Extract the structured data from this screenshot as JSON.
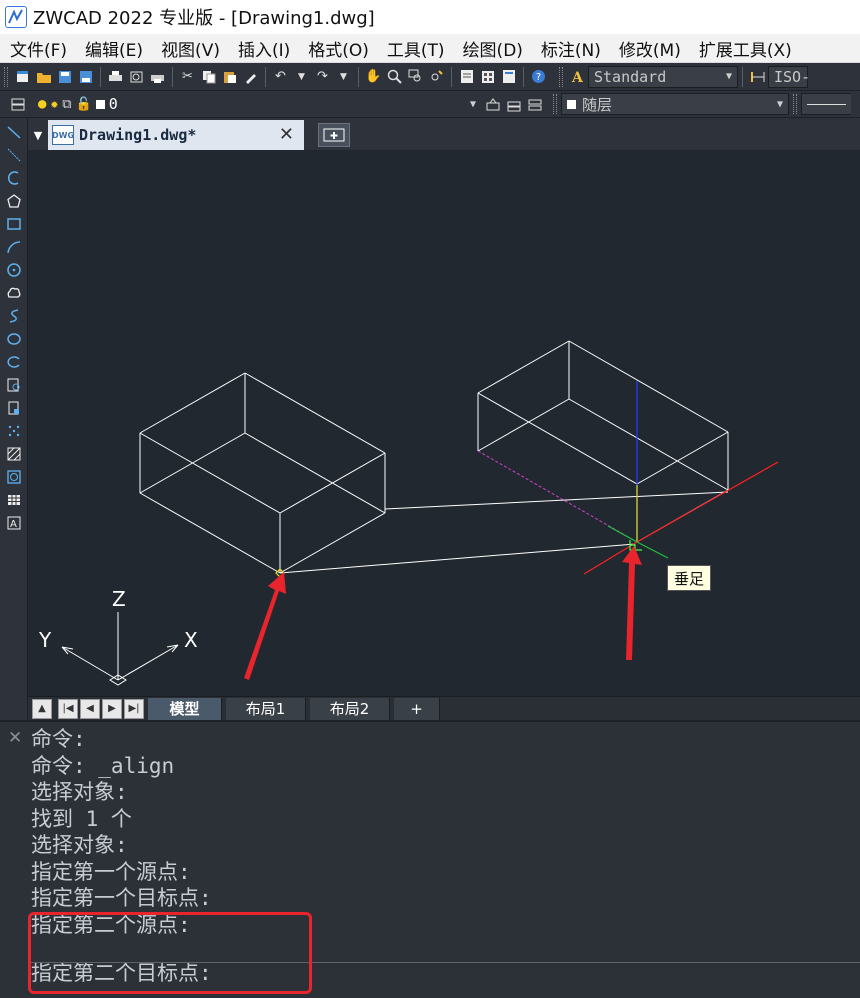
{
  "app": {
    "title": "ZWCAD 2022 专业版 - [Drawing1.dwg]"
  },
  "menu": [
    {
      "label": "文件(F)"
    },
    {
      "label": "编辑(E)"
    },
    {
      "label": "视图(V)"
    },
    {
      "label": "插入(I)"
    },
    {
      "label": "格式(O)"
    },
    {
      "label": "工具(T)"
    },
    {
      "label": "绘图(D)"
    },
    {
      "label": "标注(N)"
    },
    {
      "label": "修改(M)"
    },
    {
      "label": "扩展工具(X)"
    }
  ],
  "toolbar": {
    "text_style": "Standard",
    "dim_style": "ISO-",
    "layer_name": "0",
    "color_value": "随层"
  },
  "document": {
    "tab_label": "Drawing1.dwg*",
    "file_icon_text": "DWG"
  },
  "canvas": {
    "tooltip": "垂足",
    "ucs": {
      "x_label": "X",
      "y_label": "Y",
      "z_label": "Z"
    }
  },
  "layout_tabs": [
    {
      "label": "模型",
      "active": true
    },
    {
      "label": "布局1",
      "active": false
    },
    {
      "label": "布局2",
      "active": false
    },
    {
      "label": "+",
      "active": false
    }
  ],
  "command_history": [
    "命令:",
    "命令: _align",
    "选择对象:",
    "找到 1 个",
    "选择对象:",
    "指定第一个源点:",
    "指定第一个目标点:",
    "指定第二个源点:"
  ],
  "command_prompt": "指定第二个目标点:",
  "colors": {
    "canvas_bg": "#212830",
    "wire": "#ffffff",
    "annotation_red": "#e8242c",
    "axis_red": "#ff2020",
    "axis_green": "#20c040",
    "axis_blue": "#2040ff",
    "axis_yellow": "#e8e020"
  }
}
